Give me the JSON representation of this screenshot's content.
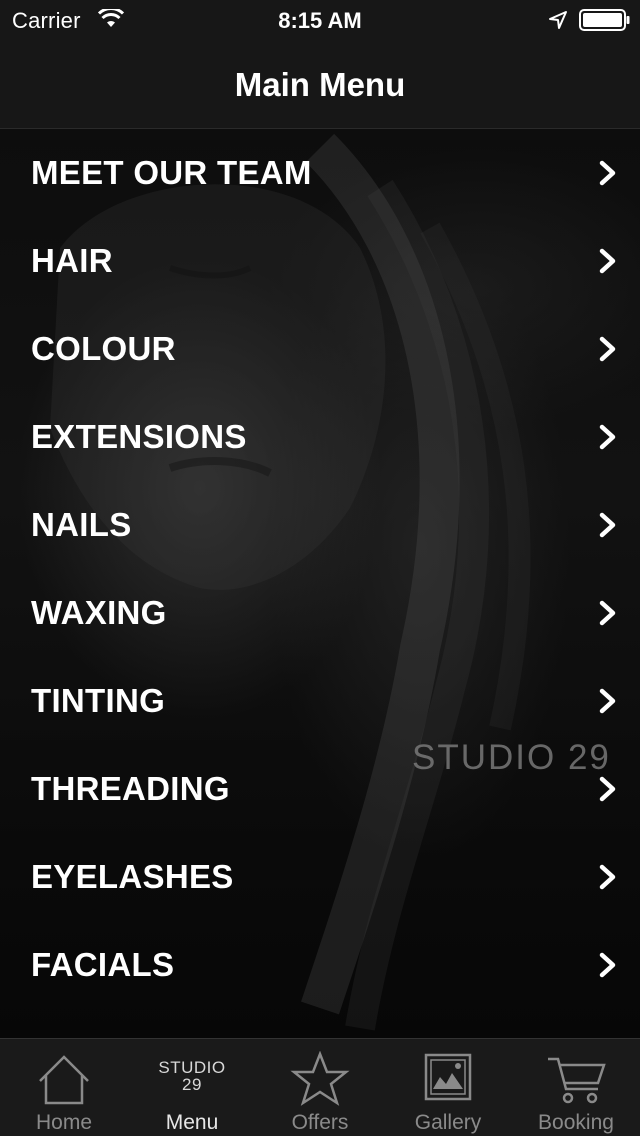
{
  "status_bar": {
    "carrier": "Carrier",
    "time": "8:15 AM",
    "icons": [
      "wifi-icon",
      "location-arrow-icon",
      "battery-icon"
    ]
  },
  "nav": {
    "title": "Main Menu"
  },
  "menu": {
    "items": [
      {
        "label": "MEET OUR TEAM",
        "icon": "chevron-right-icon"
      },
      {
        "label": "HAIR",
        "icon": "chevron-right-icon"
      },
      {
        "label": "COLOUR",
        "icon": "chevron-right-icon"
      },
      {
        "label": "EXTENSIONS",
        "icon": "chevron-right-icon"
      },
      {
        "label": "NAILS",
        "icon": "chevron-right-icon"
      },
      {
        "label": "WAXING",
        "icon": "chevron-right-icon"
      },
      {
        "label": "TINTING",
        "icon": "chevron-right-icon"
      },
      {
        "label": "THREADING",
        "icon": "chevron-right-icon"
      },
      {
        "label": "EYELASHES",
        "icon": "chevron-right-icon"
      },
      {
        "label": "FACIALS",
        "icon": "chevron-right-icon"
      }
    ]
  },
  "watermark": "STUDIO 29",
  "tab_bar": {
    "tabs": [
      {
        "label": "Home",
        "icon": "house-icon",
        "active": false
      },
      {
        "label": "Menu",
        "icon": "studio-29-logo",
        "logo_line1": "STUDIO",
        "logo_line2": "29",
        "active": true
      },
      {
        "label": "Offers",
        "icon": "star-icon",
        "active": false
      },
      {
        "label": "Gallery",
        "icon": "picture-icon",
        "active": false
      },
      {
        "label": "Booking",
        "icon": "shopping-cart-icon",
        "active": false
      }
    ]
  },
  "colors": {
    "background": "#050505",
    "bar": "#171717",
    "text": "#ffffff",
    "tab_inactive": "#8a8a8a",
    "tab_active": "#e6e6e6"
  }
}
